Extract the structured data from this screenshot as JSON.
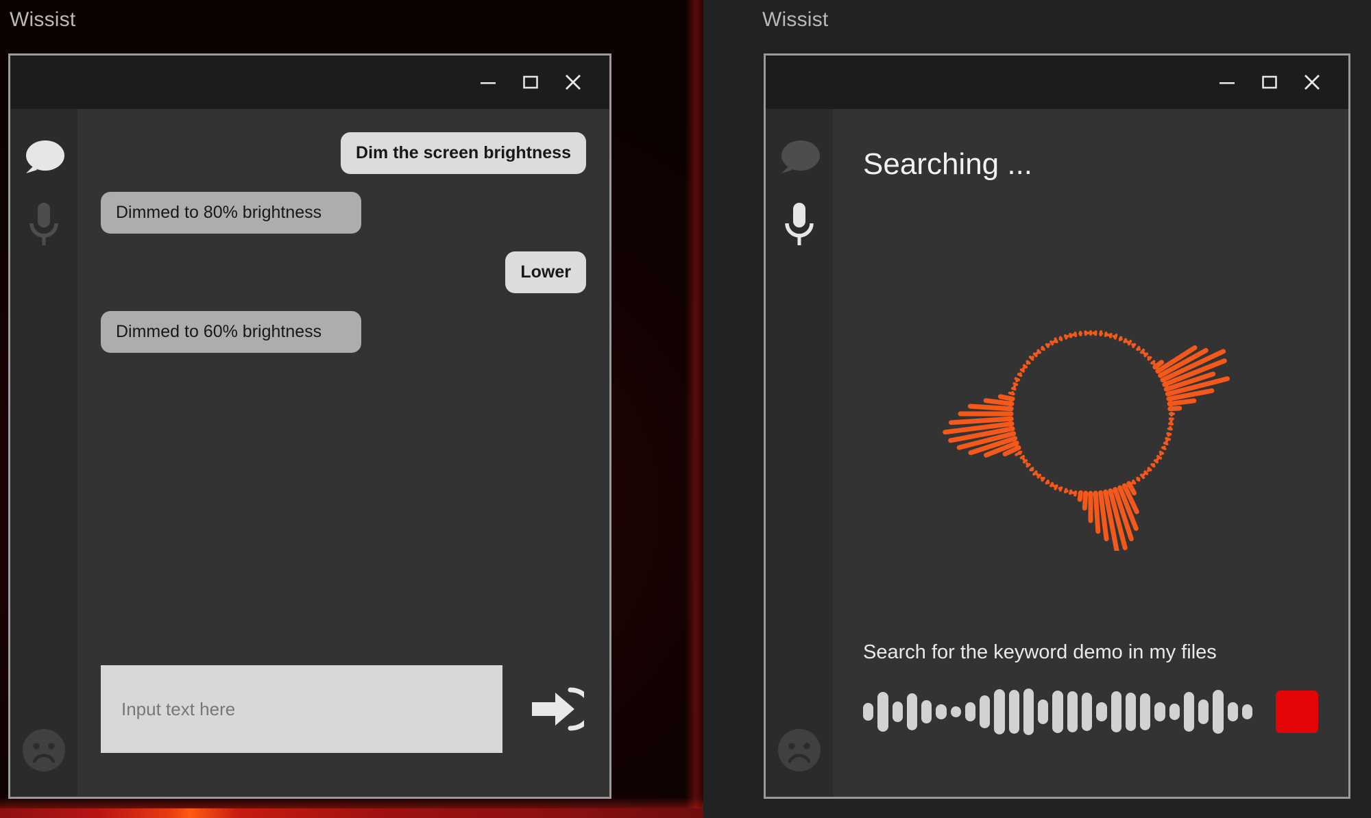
{
  "app": {
    "name": "Wissist",
    "accent_orange": "#f4581a",
    "accent_red": "#e40606",
    "bubble_user_bg": "#dcdcdc",
    "bubble_bot_bg": "#adadad",
    "window_border": "#9a9a9a",
    "content_bg": "#333333",
    "rail_bg": "#2b2b2b",
    "titlebar_bg": "#1c1c1c"
  },
  "windows": [
    {
      "id": "chat-window",
      "desktop_label": "Wissist",
      "titlebar": {
        "minimize_label": "Minimize",
        "maximize_label": "Maximize",
        "close_label": "Close"
      },
      "rail": {
        "items": [
          {
            "icon": "chat-bubble-icon",
            "label": "Chat",
            "active": true
          },
          {
            "icon": "microphone-icon",
            "label": "Voice",
            "active": false
          }
        ],
        "bottom": {
          "icon": "sad-face-icon",
          "label": "Feedback",
          "active": false
        }
      },
      "messages": [
        {
          "role": "user",
          "text": "Dim the screen brightness"
        },
        {
          "role": "bot",
          "text": "Dimmed to 80% brightness"
        },
        {
          "role": "user",
          "text": "Lower"
        },
        {
          "role": "bot",
          "text": "Dimmed to 60% brightness"
        }
      ],
      "composer": {
        "input_value": "",
        "input_placeholder": "Input text here",
        "send_icon": "send-arrow-icon",
        "send_label": "Send"
      }
    },
    {
      "id": "voice-window",
      "desktop_label": "Wissist",
      "titlebar": {
        "minimize_label": "Minimize",
        "maximize_label": "Maximize",
        "close_label": "Close"
      },
      "rail": {
        "items": [
          {
            "icon": "chat-bubble-icon",
            "label": "Chat",
            "active": false
          },
          {
            "icon": "microphone-icon",
            "label": "Voice",
            "active": true
          }
        ],
        "bottom": {
          "icon": "sad-face-icon",
          "label": "Feedback",
          "active": false
        }
      },
      "status_title": "Searching ...",
      "transcript": "Search for the keyword demo in my files",
      "radial_visualizer": {
        "icon": "radial-waveform-icon",
        "color": "#f4581a",
        "ring_style": "dotted",
        "bar_lengths": [
          2,
          2,
          3,
          2,
          2,
          3,
          2,
          2,
          3,
          2,
          2,
          3,
          2,
          2,
          2,
          10,
          62,
          74,
          96,
          92,
          70,
          88,
          62,
          34,
          12,
          3,
          2,
          2,
          2,
          2,
          3,
          2,
          2,
          2,
          3,
          2,
          2,
          2,
          2,
          3,
          2,
          2,
          14,
          40,
          62,
          74,
          84,
          88,
          66,
          54,
          38,
          20,
          8,
          3,
          2,
          2,
          2,
          3,
          2,
          2,
          2,
          2,
          3,
          2,
          2,
          2,
          2,
          6,
          20,
          46,
          66,
          80,
          90,
          96,
          86,
          72,
          58,
          36,
          16,
          4,
          2,
          2,
          3,
          2,
          2,
          2,
          2,
          3,
          2,
          2,
          2,
          2,
          2,
          3,
          2,
          2,
          2,
          2,
          2,
          2
        ]
      },
      "voice_controls": {
        "waveform_icon": "audio-waveform-icon",
        "waveform_levels": [
          34,
          76,
          40,
          70,
          46,
          30,
          22,
          38,
          62,
          88,
          84,
          90,
          48,
          82,
          80,
          74,
          36,
          78,
          74,
          70,
          38,
          32,
          76,
          48,
          84,
          36,
          30
        ],
        "stop_button": {
          "icon": "stop-square-icon",
          "label": "Stop",
          "color": "#e40606"
        }
      }
    }
  ]
}
